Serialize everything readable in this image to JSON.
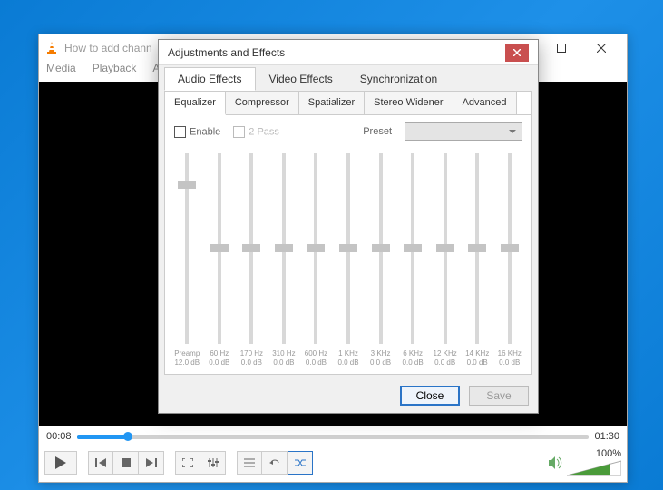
{
  "vlc": {
    "title": "How to add chann",
    "menu": [
      "Media",
      "Playback",
      "A"
    ],
    "time_current": "00:08",
    "time_total": "01:30",
    "volume_pct": "100%"
  },
  "dialog": {
    "title": "Adjustments and Effects",
    "main_tabs": [
      "Audio Effects",
      "Video Effects",
      "Synchronization"
    ],
    "sub_tabs": [
      "Equalizer",
      "Compressor",
      "Spatializer",
      "Stereo Widener",
      "Advanced"
    ],
    "enable_label": "Enable",
    "twopass_label": "2 Pass",
    "preset_label": "Preset",
    "preamp_label": "Preamp",
    "preamp_value": "12.0 dB",
    "bands": [
      {
        "freq": "60 Hz",
        "val": "0.0 dB"
      },
      {
        "freq": "170 Hz",
        "val": "0.0 dB"
      },
      {
        "freq": "310 Hz",
        "val": "0.0 dB"
      },
      {
        "freq": "600 Hz",
        "val": "0.0 dB"
      },
      {
        "freq": "1 KHz",
        "val": "0.0 dB"
      },
      {
        "freq": "3 KHz",
        "val": "0.0 dB"
      },
      {
        "freq": "6 KHz",
        "val": "0.0 dB"
      },
      {
        "freq": "12 KHz",
        "val": "0.0 dB"
      },
      {
        "freq": "14 KHz",
        "val": "0.0 dB"
      },
      {
        "freq": "16 KHz",
        "val": "0.0 dB"
      }
    ],
    "close_label": "Close",
    "save_label": "Save"
  }
}
